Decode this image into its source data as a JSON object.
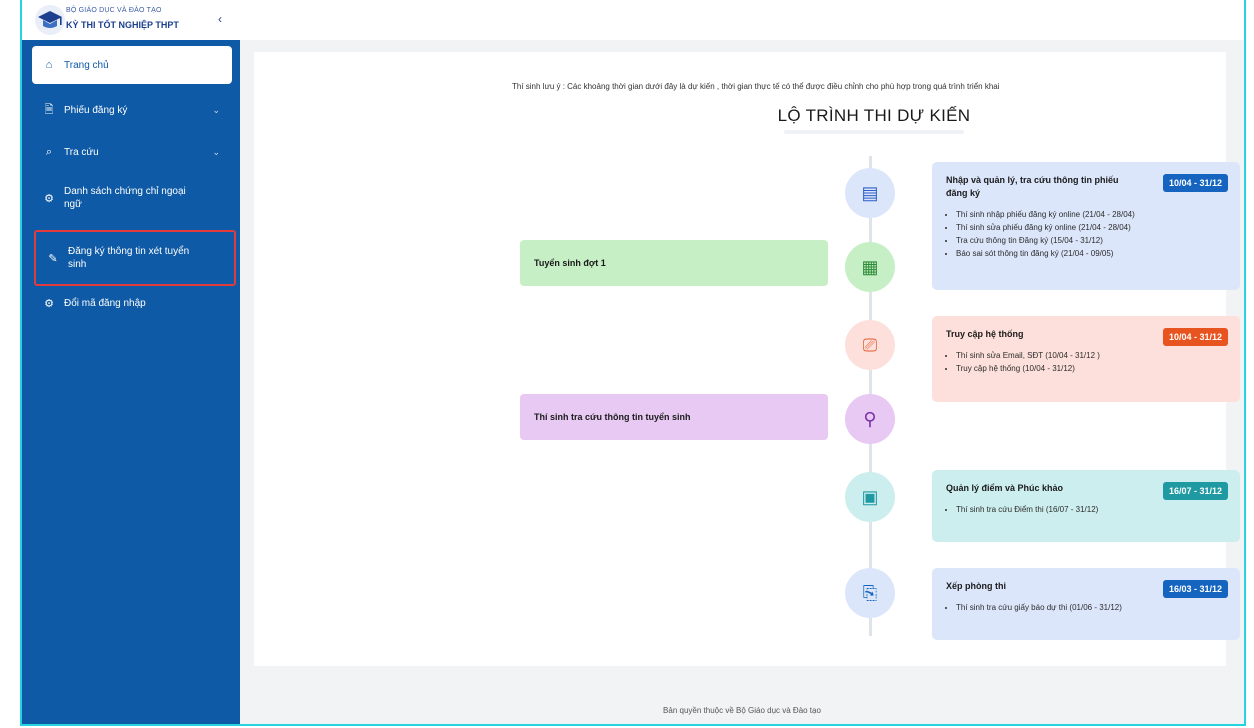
{
  "header": {
    "brand_line1": "BỘ GIÁO DỤC VÀ ĐÀO TẠO",
    "brand_line2": "KỲ THI TỐT NGHIỆP THPT",
    "collapse_icon": "chevron-left-icon"
  },
  "sidebar": {
    "items": [
      {
        "label": "Trang chủ",
        "icon": "home-icon"
      },
      {
        "label": "Phiếu đăng ký",
        "icon": "document-icon"
      },
      {
        "label": "Tra cứu",
        "icon": "search-icon"
      },
      {
        "label_line1": "Danh sách chứng chỉ ngoại",
        "label_line2": "ngữ",
        "icon": "gear-icon"
      },
      {
        "label_line1": "Đăng ký thông tin xét tuyển",
        "label_line2": "sinh",
        "icon": "edit-icon"
      },
      {
        "label": "Đổi mã đăng nhập",
        "icon": "gear-icon"
      }
    ]
  },
  "main": {
    "notice": "Thí sinh lưu ý : Các khoảng thời gian dưới đây là dự kiến , thời gian thực tế có thể được điều chỉnh cho phù hợp trong quá trình triển khai",
    "timeline_title": "LỘ TRÌNH THI DỰ KIẾN",
    "left_boxes": [
      {
        "label": "Tuyển sinh đợt 1"
      },
      {
        "label": "Thí sinh tra cứu thông tin tuyển sinh"
      }
    ],
    "cards": [
      {
        "title": "Nhập và quản lý, tra cứu thông tin phiếu đăng ký",
        "date": "10/04 - 31/12",
        "items": [
          "Thí sinh nhập phiếu đăng ký online (21/04 - 28/04)",
          "Thí sinh sửa phiếu đăng ký online (21/04 - 28/04)",
          "Tra cứu thông tin Đăng ký (15/04 - 31/12)",
          "Báo sai sót thông tin đăng ký (21/04 - 09/05)"
        ]
      },
      {
        "title": "Truy cập hệ thống",
        "date": "10/04 - 31/12",
        "items": [
          "Thí sinh sửa Email, SĐT (10/04 - 31/12 )",
          "Truy cập hệ thống (10/04 - 31/12)"
        ]
      },
      {
        "title": "Quản lý điểm và Phúc khảo",
        "date": "16/07 - 31/12",
        "items": [
          "Thí sinh tra cứu Điểm thi (16/07 - 31/12)"
        ]
      },
      {
        "title": "Xếp phòng thi",
        "date": "16/03 - 31/12",
        "items": [
          "Thí sinh tra cứu giấy báo dự thi (01/06 - 31/12)"
        ]
      }
    ],
    "nodes": [
      {
        "icon": "list-document-icon"
      },
      {
        "icon": "calendar-check-icon"
      },
      {
        "icon": "monitor-user-icon"
      },
      {
        "icon": "magnifier-icon"
      },
      {
        "icon": "clipboard-icon"
      },
      {
        "icon": "file-edit-icon"
      }
    ]
  },
  "footer": {
    "text": "Bản quyền thuộc về Bộ Giáo dục và Đào tạo"
  },
  "colors": {
    "sidebar": "#0e5aa6",
    "accent_blue": "#1565c0",
    "accent_orange": "#e8541f",
    "accent_teal": "#1f9aa3",
    "highlight_border": "#e23b3b",
    "frame_border": "#27d3e0"
  }
}
